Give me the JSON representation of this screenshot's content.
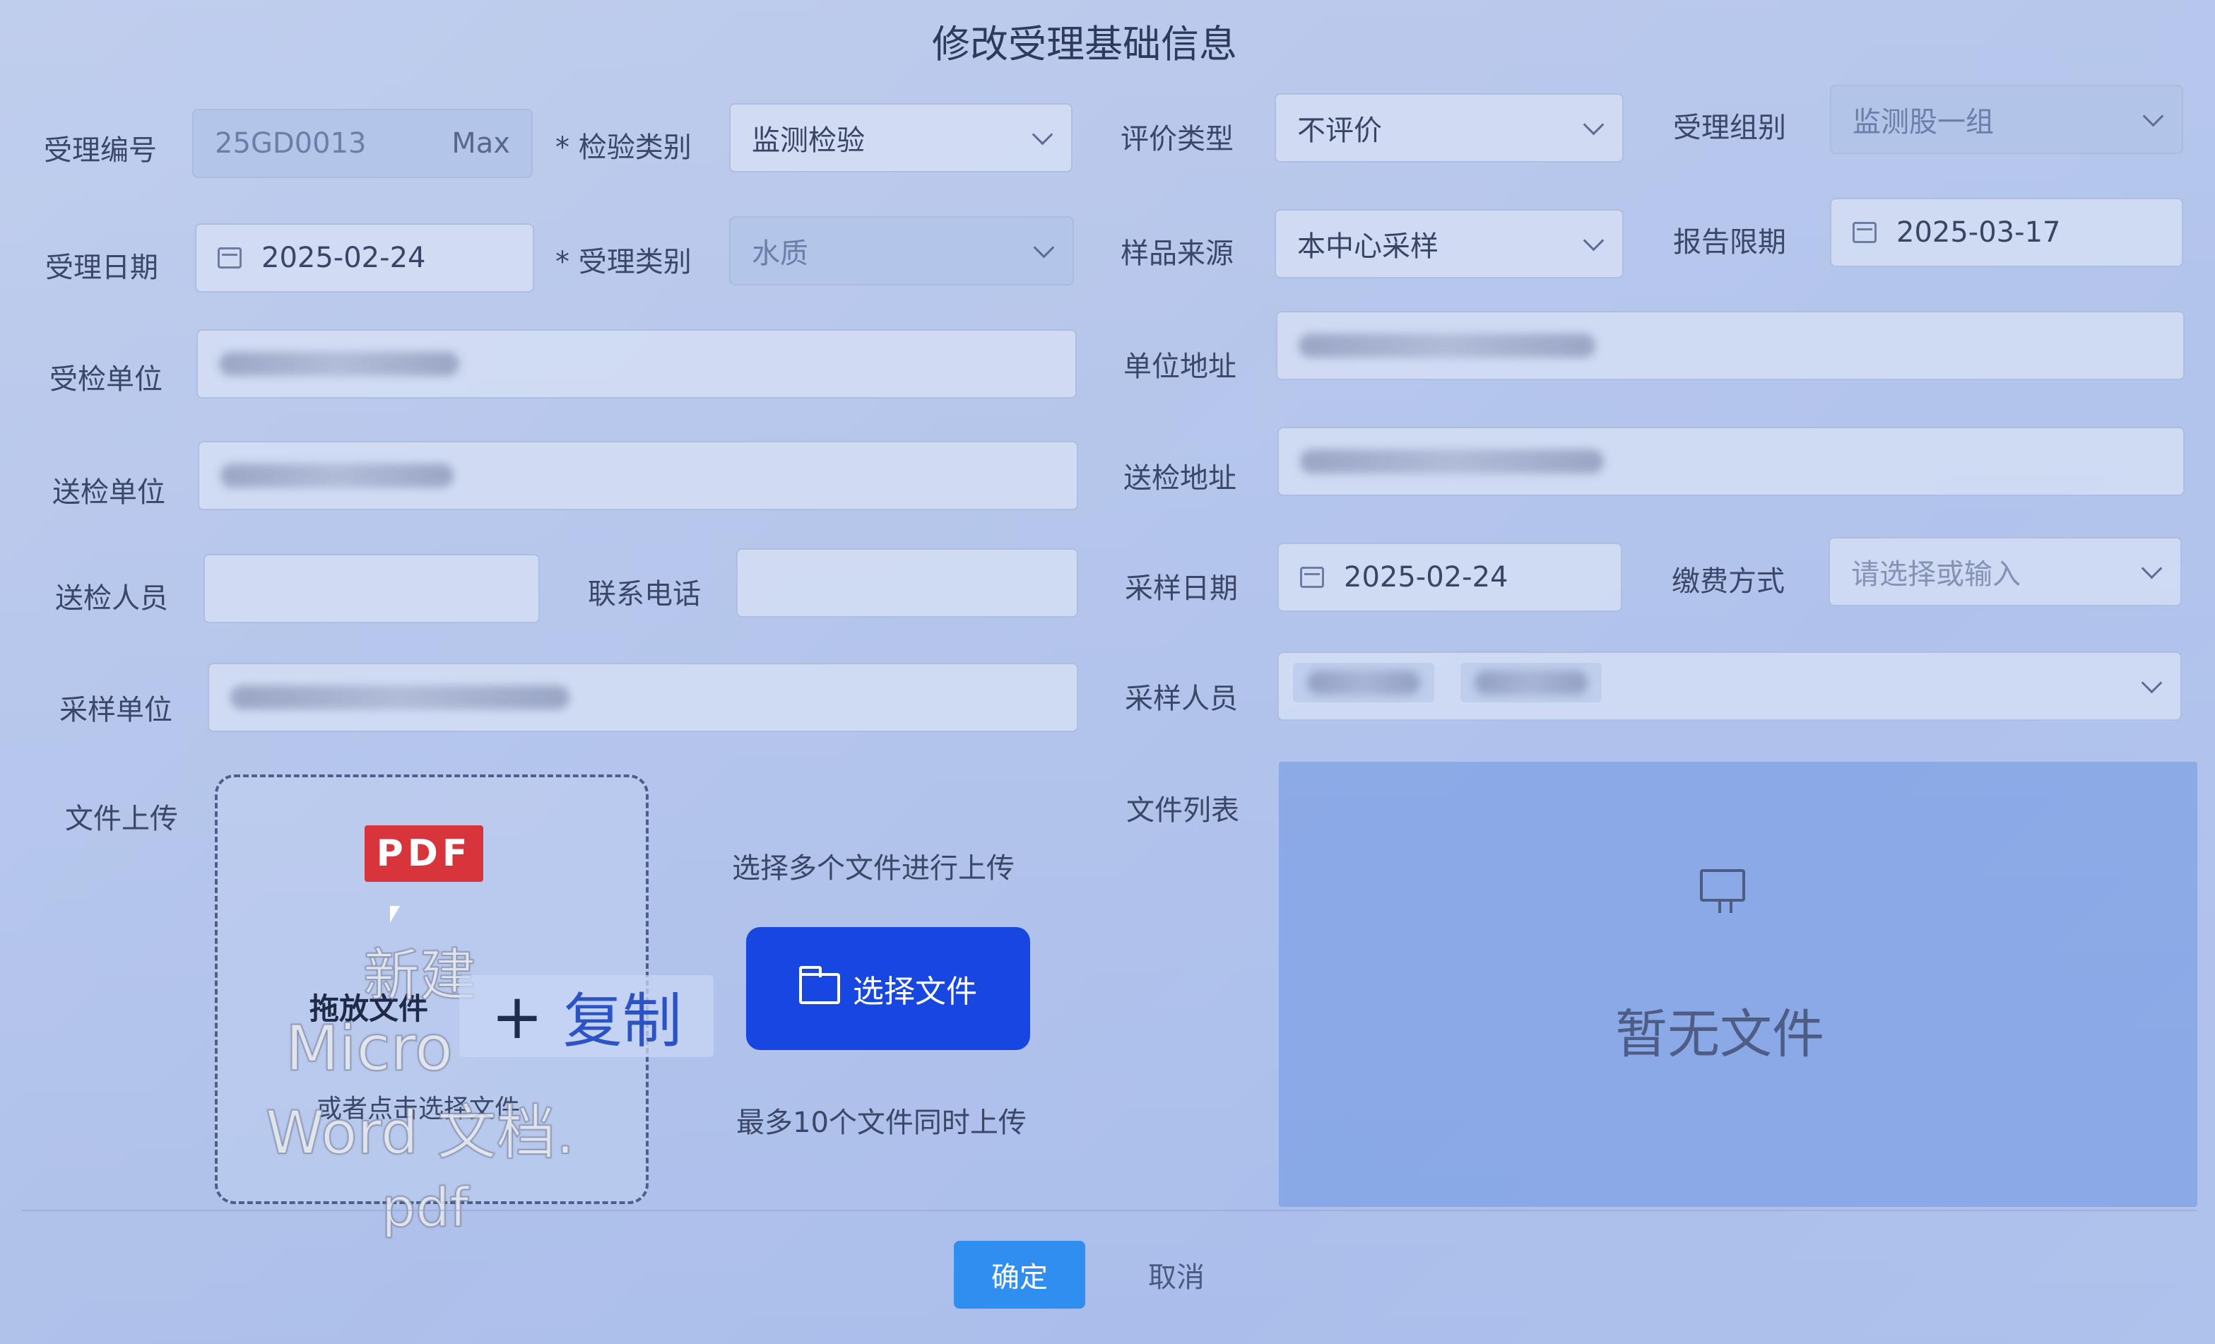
{
  "dialog": {
    "title": "修改受理基础信息"
  },
  "form": {
    "accept_no": {
      "label": "受理编号",
      "value": "25GD0013",
      "suffix": "Max"
    },
    "inspect_category": {
      "label": "* 检验类别",
      "value": "监测检验"
    },
    "eval_type": {
      "label": "评价类型",
      "value": "不评价"
    },
    "accept_group": {
      "label": "受理组别",
      "value": "监测股一组"
    },
    "accept_date": {
      "label": "受理日期",
      "value": "2025-02-24"
    },
    "accept_category": {
      "label": "* 受理类别",
      "value": "水质"
    },
    "sample_source": {
      "label": "样品来源",
      "value": "本中心采样"
    },
    "report_deadline": {
      "label": "报告限期",
      "value": "2025-03-17"
    },
    "inspected_unit": {
      "label": "受检单位"
    },
    "unit_address": {
      "label": "单位地址"
    },
    "sender_unit": {
      "label": "送检单位"
    },
    "sender_address": {
      "label": "送检地址"
    },
    "sender_person": {
      "label": "送检人员",
      "value": ""
    },
    "contact_phone": {
      "label": "联系电话",
      "value": ""
    },
    "sampling_date": {
      "label": "采样日期",
      "value": "2025-02-24"
    },
    "payment_method": {
      "label": "缴费方式",
      "placeholder": "请选择或输入"
    },
    "sampling_unit": {
      "label": "采样单位"
    },
    "sampling_person": {
      "label": "采样人员"
    }
  },
  "upload": {
    "label": "文件上传",
    "drop_title": "拖放文件",
    "drop_hint": "或者点击选择文件",
    "multi_hint": "选择多个文件进行上传",
    "select_button": "选择文件",
    "limit_hint": "最多10个文件同时上传",
    "drag_preview": {
      "badge": "PDF",
      "ghost_line1": "新建",
      "ghost_line2": "Micro",
      "ghost_line3": "Word 文档.",
      "ghost_line4": "pdf",
      "copy_plus": "+",
      "copy_label": "复制"
    }
  },
  "file_list": {
    "label": "文件列表",
    "empty_text": "暂无文件"
  },
  "footer": {
    "ok_label": "确定",
    "cancel_label": "取消"
  },
  "icons": {
    "date": "calendar-icon",
    "dropdown": "chevron-down-icon",
    "folder": "folder-icon",
    "empty": "empty-box-icon"
  },
  "colors": {
    "primary_button": "#1747e0",
    "ok_button": "#2f8ef0",
    "pdf_badge": "#d8343c"
  }
}
